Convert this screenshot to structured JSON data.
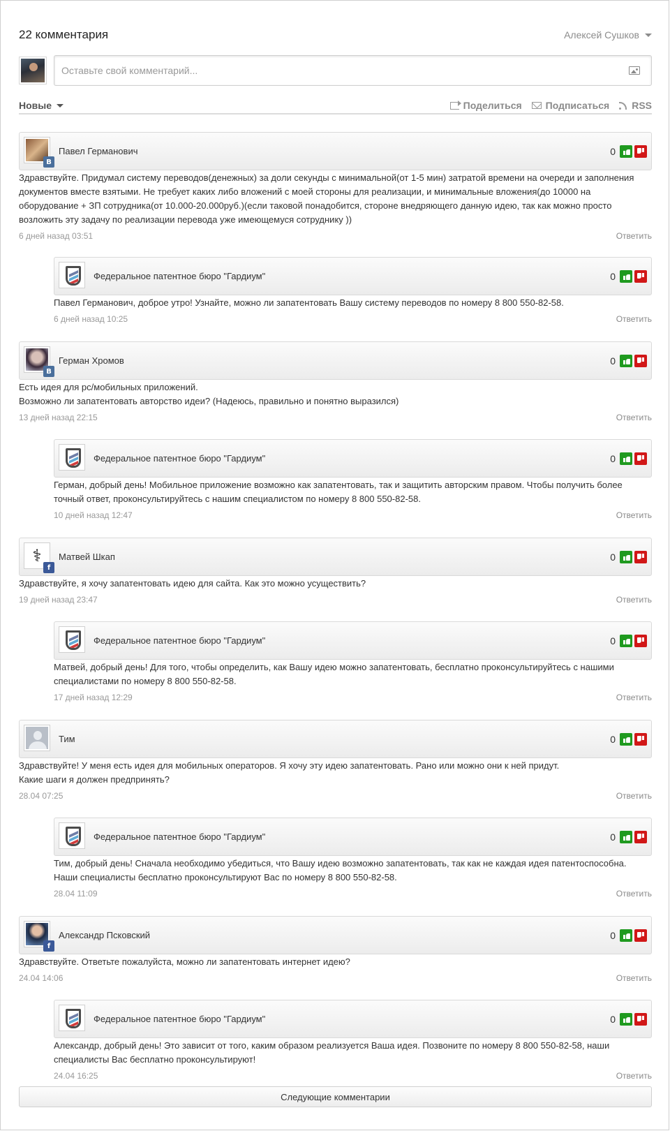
{
  "header": {
    "count_label": "22 комментария",
    "user_name": "Алексей Сушков"
  },
  "new_comment": {
    "placeholder": "Оставьте свой комментарий..."
  },
  "toolbar": {
    "sort_label": "Новые",
    "share_label": "Поделиться",
    "subscribe_label": "Подписаться",
    "rss_label": "RSS"
  },
  "reply_label": "Ответить",
  "comments": [
    {
      "name": "Павел Германович",
      "network": "В",
      "votes": "0",
      "text": "Здравствуйте. Придумал систему переводов(денежных) за доли секунды с минимальной(от 1-5 мин) затратой времени на очереди и заполнения документов вместе взятыми. Не требует каких либо вложений с моей стороны для реализации, и минимальные вложения(до 10000 на оборудование + ЗП сотрудника(от 10.000-20.000руб.)(если таковой понадобится,  стороне внедряющего данную идею, так как можно просто возложить эту задачу по реализации перевода уже имеющемуся сотруднику ))",
      "time": "6 дней назад 03:51"
    },
    {
      "name": "Федеральное патентное бюро \"Гардиум\"",
      "votes": "0",
      "text": "Павел Германович, доброе утро! Узнайте, можно ли запатентовать Вашу систему переводов по номеру 8 800 550-82-58.",
      "time": "6 дней назад 10:25"
    },
    {
      "name": "Герман Хромов",
      "network": "В",
      "votes": "0",
      "text": "Есть идея для pc/мобильных приложений.\nВозможно ли запатентовать авторство идеи? (Надеюсь, правильно и понятно выразился)",
      "time": "13 дней назад 22:15"
    },
    {
      "name": "Федеральное патентное бюро \"Гардиум\"",
      "votes": "0",
      "text": "Герман, добрый день! Мобильное приложение возможно как запатентовать, так и защитить авторским правом. Чтобы получить более точный ответ, проконсультируйтесь с нашим специалистом по номеру 8 800 550-82-58.",
      "time": "10 дней назад 12:47"
    },
    {
      "name": "Матвей Шкап",
      "network": "f",
      "votes": "0",
      "text": "Здравствуйте, я хочу запатентовать идею для сайта. Как это можно усуществить?",
      "time": "19 дней назад 23:47"
    },
    {
      "name": "Федеральное патентное бюро \"Гардиум\"",
      "votes": "0",
      "text": "Матвей, добрый день! Для того, чтобы определить, как Вашу идею можно запатентовать, бесплатно проконсультируйтесь с нашими специалистами по номеру 8 800 550-82-58.",
      "time": "17 дней назад 12:29"
    },
    {
      "name": "Тим",
      "votes": "0",
      "text": "Здравствуйте! У меня есть идея для мобильных операторов. Я хочу эту идею запатентовать. Рано или можно они к ней придут.\nКакие шаги я должен предпринять?",
      "time": "28.04 07:25"
    },
    {
      "name": "Федеральное патентное бюро \"Гардиум\"",
      "votes": "0",
      "text": "Тим, добрый день! Сначала необходимо убедиться, что Вашу идею возможно запатентовать, так как не каждая идея патентоспособна. Наши специалисты бесплатно проконсультируют Вас по номеру 8 800 550-82-58.",
      "time": "28.04 11:09"
    },
    {
      "name": "Александр Псковский",
      "network": "f",
      "votes": "0",
      "text": "Здравствуйте. Ответьте пожалуйста, можно ли запатентовать интернет идею?",
      "time": "24.04 14:06"
    },
    {
      "name": "Федеральное патентное бюро \"Гардиум\"",
      "votes": "0",
      "text": "Александр, добрый день! Это зависит от того, каким образом реализуется Ваша идея. Позвоните по номеру 8 800 550-82-58, наши специалисты Вас бесплатно проконсультируют!",
      "time": "24.04 16:25"
    }
  ],
  "next_label": "Следующие комментарии"
}
